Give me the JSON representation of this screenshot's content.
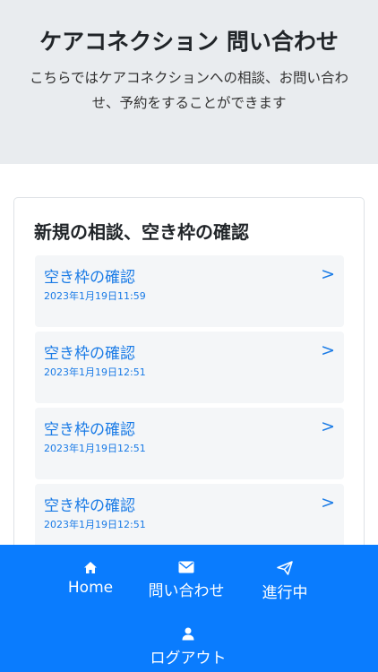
{
  "header": {
    "title": "ケアコネクション 問い合わせ",
    "subtitle": "こちらではケアコネクションへの相談、お問い合わせ、予約をすることができます"
  },
  "card": {
    "title": "新規の相談、空き枠の確認",
    "items": [
      {
        "title": "空き枠の確認",
        "date": "2023年1月19日11:59",
        "chevron": ">"
      },
      {
        "title": "空き枠の確認",
        "date": "2023年1月19日12:51",
        "chevron": ">"
      },
      {
        "title": "空き枠の確認",
        "date": "2023年1月19日12:51",
        "chevron": ">"
      },
      {
        "title": "空き枠の確認",
        "date": "2023年1月19日12:51",
        "chevron": ">"
      }
    ]
  },
  "nav": {
    "home": {
      "label": "Home",
      "icon": "home-icon"
    },
    "inquiry": {
      "label": "問い合わせ",
      "icon": "envelope-icon"
    },
    "in_progress": {
      "label": "進行中",
      "icon": "paper-plane-icon"
    },
    "logout": {
      "label": "ログアウト",
      "icon": "person-icon"
    }
  },
  "colors": {
    "accent": "#0a7cfe",
    "link": "#1a7be6",
    "header_bg": "#e9ecef"
  }
}
